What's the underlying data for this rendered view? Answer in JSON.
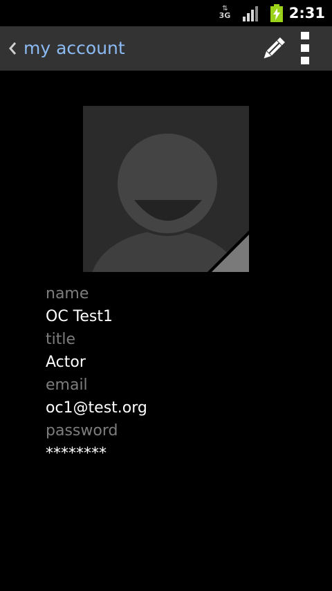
{
  "status_bar": {
    "network_type": "3G",
    "network_arrows": "⇅",
    "time": "2:31",
    "icons": [
      "data-3g-icon",
      "signal-strength-icon",
      "battery-charging-icon"
    ]
  },
  "action_bar": {
    "title": "my account",
    "icons": [
      "back-chevron-icon",
      "pencil-icon",
      "overflow-menu-icon"
    ]
  },
  "profile": {
    "avatar_icon": "default-user-avatar-icon",
    "fields": [
      {
        "label": "name",
        "value": "OC Test1"
      },
      {
        "label": "title",
        "value": "Actor"
      },
      {
        "label": "email",
        "value": "oc1@test.org"
      },
      {
        "label": "password",
        "value": "********"
      }
    ]
  },
  "colors": {
    "title_blue": "#8cbbf4",
    "action_bar_bg": "#333333",
    "label_gray": "#7d7d7d",
    "battery_green": "#9bd21a"
  }
}
